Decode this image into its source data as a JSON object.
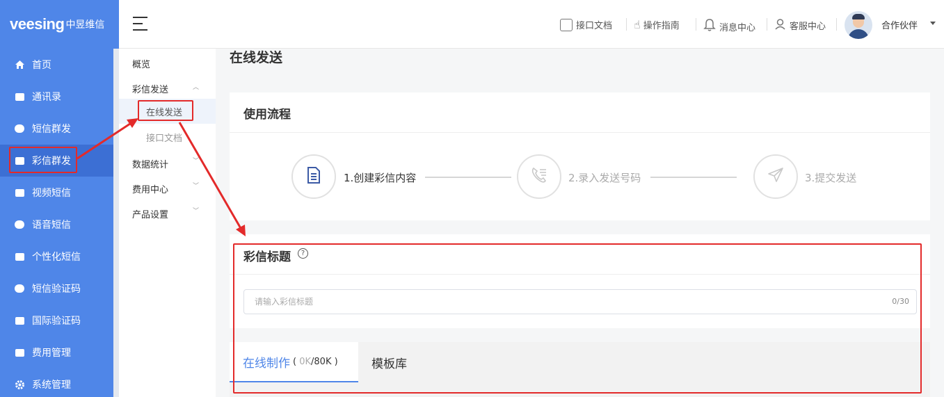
{
  "logo": {
    "brand": "veesing",
    "cn": "中昱维信"
  },
  "nav": [
    {
      "label": "首页",
      "icon": "home-icon"
    },
    {
      "label": "通讯录",
      "icon": "contacts-icon"
    },
    {
      "label": "短信群发",
      "icon": "sms-icon"
    },
    {
      "label": "彩信群发",
      "icon": "mms-icon",
      "active": true
    },
    {
      "label": "视频短信",
      "icon": "video-sms-icon"
    },
    {
      "label": "语音短信",
      "icon": "voice-sms-icon"
    },
    {
      "label": "个性化短信",
      "icon": "personalized-sms-icon"
    },
    {
      "label": "短信验证码",
      "icon": "sms-code-icon"
    },
    {
      "label": "国际验证码",
      "icon": "intl-code-icon"
    },
    {
      "label": "费用管理",
      "icon": "yen-icon"
    },
    {
      "label": "系统管理",
      "icon": "gear-icon"
    }
  ],
  "subnav": {
    "overview": "概览",
    "mms_send": "彩信发送",
    "online_send": "在线发送",
    "api_docs": "接口文档",
    "statistics": "数据统计",
    "billing": "费用中心",
    "product_settings": "产品设置"
  },
  "header": {
    "links": [
      {
        "label": "接口文档",
        "icon": "api-doc-icon"
      },
      {
        "label": "操作指南",
        "icon": "hand-pointer-icon"
      },
      {
        "label": "消息中心",
        "icon": "bell-icon"
      },
      {
        "label": "客服中心",
        "icon": "support-icon"
      }
    ],
    "user": "合作伙伴"
  },
  "main": {
    "page_title": "在线发送",
    "flow": {
      "title": "使用流程",
      "steps": [
        "1.创建彩信内容",
        "2.录入发送号码",
        "3.提交发送"
      ]
    },
    "mms_title": {
      "label": "彩信标题",
      "help_glyph": "?",
      "placeholder": "请输入彩信标题",
      "counter": "0/30"
    },
    "tabs": {
      "online_label": "在线制作",
      "online_size_open": "( ",
      "online_size_used": "0K",
      "online_size_total": "/80K",
      "online_size_close": " )",
      "template_label": "模板库"
    }
  },
  "colors": {
    "sidebar": "#4f86e8",
    "accent": "#4f86e8",
    "annotation": "#e32a2a"
  }
}
